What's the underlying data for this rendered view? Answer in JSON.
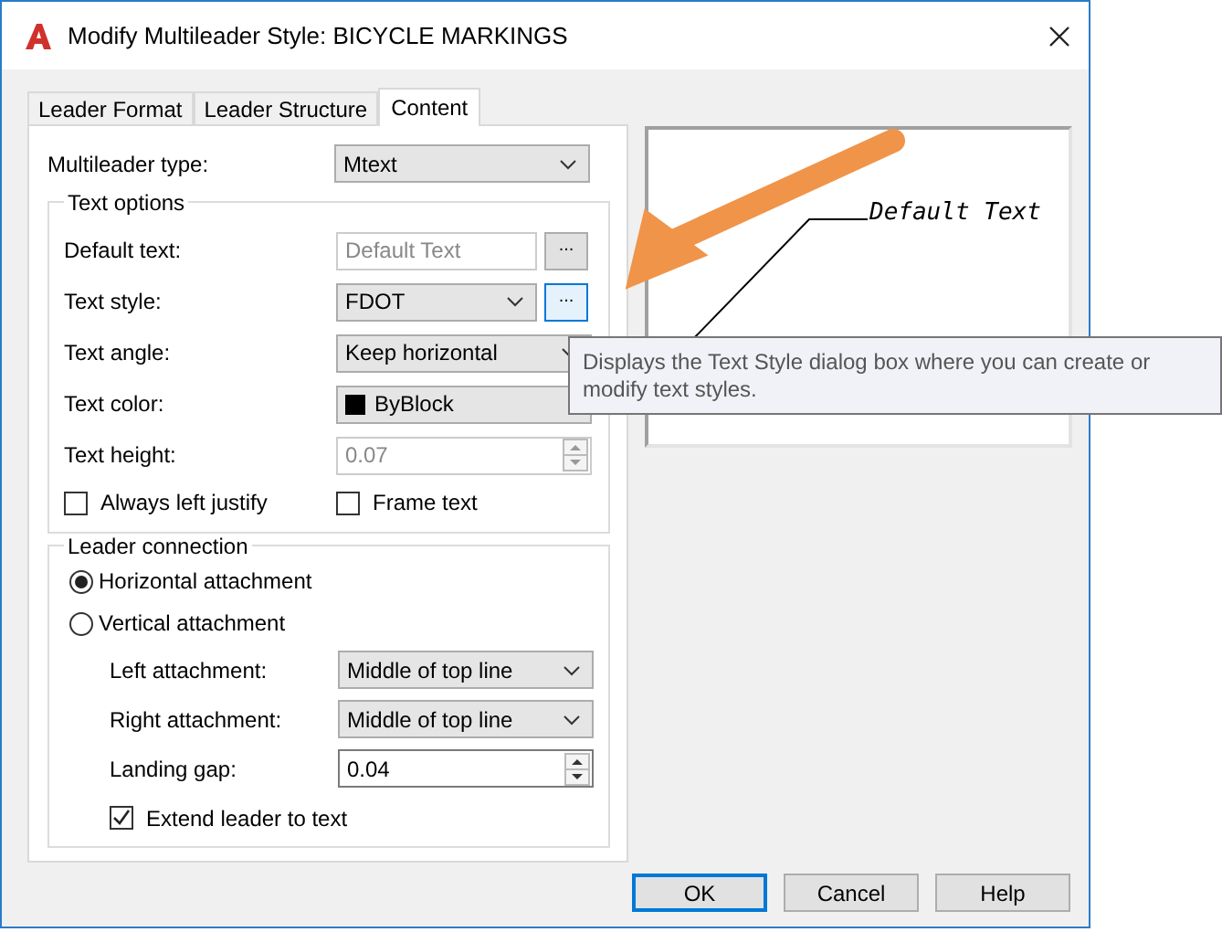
{
  "window": {
    "title": "Modify Multileader Style: BICYCLE MARKINGS"
  },
  "tabs": [
    {
      "label": "Leader Format",
      "selected": false
    },
    {
      "label": "Leader Structure",
      "selected": false
    },
    {
      "label": "Content",
      "selected": true
    }
  ],
  "multileader_type": {
    "label": "Multileader type:",
    "value": "Mtext"
  },
  "text_options": {
    "title": "Text options",
    "rows": [
      {
        "kind": "text-button",
        "label": "Default text:",
        "value": "Default Text",
        "disabled": true,
        "button": "...",
        "focused": false
      },
      {
        "kind": "select-button",
        "label": "Text style:",
        "value": "FDOT",
        "button": "...",
        "focused": true
      },
      {
        "kind": "select",
        "label": "Text angle:",
        "value": "Keep horizontal"
      },
      {
        "kind": "color-select",
        "label": "Text color:",
        "value": "ByBlock",
        "color": "#000000"
      },
      {
        "kind": "spinner",
        "label": "Text height:",
        "value": "0.07",
        "disabled": true
      }
    ],
    "checkboxes": [
      {
        "label": "Always left justify",
        "checked": false
      },
      {
        "label": "Frame text",
        "checked": false
      }
    ]
  },
  "leader_connection": {
    "title": "Leader connection",
    "radios": [
      {
        "label": "Horizontal attachment",
        "selected": true
      },
      {
        "label": "Vertical attachment",
        "selected": false
      }
    ],
    "rows": [
      {
        "kind": "select",
        "label": "Left attachment:",
        "value": "Middle of top line"
      },
      {
        "kind": "select",
        "label": "Right attachment:",
        "value": "Middle of top line"
      },
      {
        "kind": "spinner",
        "label": "Landing gap:",
        "value": "0.04",
        "disabled": false
      }
    ],
    "checkbox": {
      "label": "Extend leader to text",
      "checked": true
    }
  },
  "preview": {
    "text": "Default Text"
  },
  "tooltip": "Displays the Text Style dialog box where you can create or modify text styles.",
  "buttons": [
    {
      "label": "OK",
      "default": true
    },
    {
      "label": "Cancel",
      "default": false
    },
    {
      "label": "Help",
      "default": false
    }
  ]
}
